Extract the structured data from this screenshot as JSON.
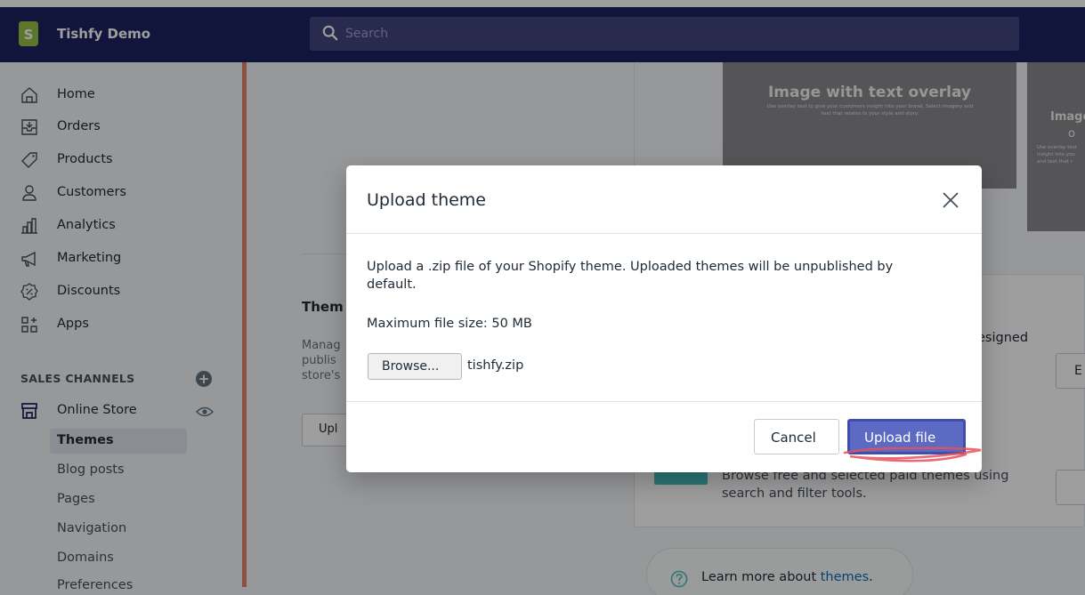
{
  "topbar": {
    "store_initial": "S",
    "store_name": "Tishfy Demo",
    "search_placeholder": "Search"
  },
  "sidebar": {
    "items": [
      {
        "label": "Home",
        "icon": "home-icon"
      },
      {
        "label": "Orders",
        "icon": "orders-icon"
      },
      {
        "label": "Products",
        "icon": "tag-icon"
      },
      {
        "label": "Customers",
        "icon": "person-icon"
      },
      {
        "label": "Analytics",
        "icon": "bar-chart-icon"
      },
      {
        "label": "Marketing",
        "icon": "megaphone-icon"
      },
      {
        "label": "Discounts",
        "icon": "discount-icon"
      },
      {
        "label": "Apps",
        "icon": "apps-icon"
      }
    ],
    "sales_channels_title": "SALES CHANNELS",
    "online_store_label": "Online Store",
    "sub_items": [
      {
        "label": "Themes",
        "active": true
      },
      {
        "label": "Blog posts",
        "active": false
      },
      {
        "label": "Pages",
        "active": false
      },
      {
        "label": "Navigation",
        "active": false
      },
      {
        "label": "Domains",
        "active": false
      },
      {
        "label": "Preferences",
        "active": false
      }
    ]
  },
  "background": {
    "preview_title": "Image with text overlay",
    "preview_sub": "Use overlay text to give your customers insight into your brand. Select imagery and text that relates to your style and story.",
    "preview2_title": "Image",
    "preview2_o": "o",
    "preview2_sub": "Use overlay text insight into you and text that r",
    "themes_heading": "Them",
    "themes_desc": "Manag publis store's",
    "upload_btn_partial": "Upl",
    "card_text": "esigned",
    "ex_btn": "E",
    "browse_text": "Browse free and selected paid themes using search and filter tools.",
    "v_btn": "",
    "learn_prefix": "Learn more about ",
    "learn_link": "themes",
    "learn_suffix": "."
  },
  "modal": {
    "title": "Upload theme",
    "description": "Upload a .zip file of your Shopify theme. Uploaded themes will be unpublished by default.",
    "max_size": "Maximum file size: 50 MB",
    "browse_label": "Browse...",
    "file_name": "tishfy.zip",
    "cancel_label": "Cancel",
    "upload_label": "Upload file"
  },
  "colors": {
    "topbar": "#1c2260",
    "primary_button": "#5c6ac4",
    "accent_bar": "#e3826a",
    "annotation": "#e8505b"
  }
}
